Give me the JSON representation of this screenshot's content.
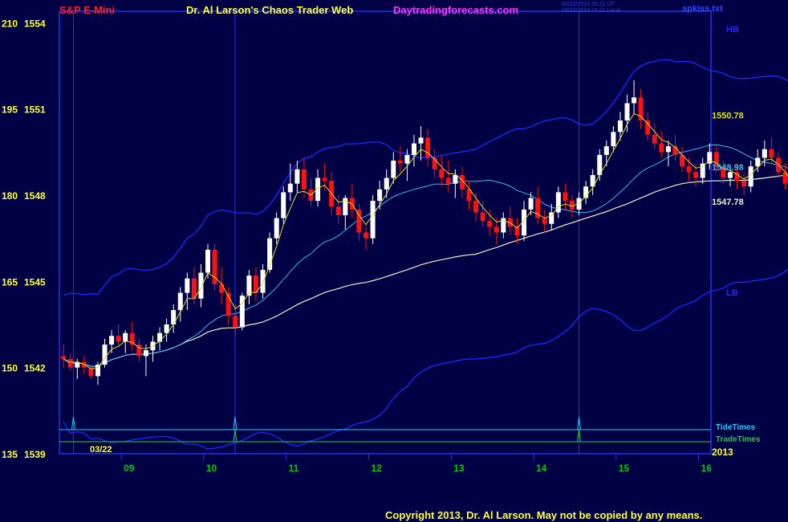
{
  "header": {
    "symbol": "S&P E-Mini",
    "site_title": "Dr. Al Larson's Chaos Trader Web",
    "site_url": "Daytradingforecasts.com",
    "timestamp_ut": "03/22/2013 20:21 UT",
    "timestamp_local": "03/22/2013 15:21 Local",
    "file": "spkiss.txt"
  },
  "footer": {
    "copyright": "Copyright 2013, Dr. Al Larson. May not be copied by any means."
  },
  "colors": {
    "background": "#000044",
    "frame": "#2233ee",
    "band": "#1a2bff",
    "cyan_ma": "#33bbee",
    "white_ma": "#eeeecc",
    "yellow_ma": "#dddd22",
    "up_candle": "#ffffff",
    "down_candle": "#ff1111",
    "tide_times": "#22ccff",
    "trade_times": "#22cc44",
    "date_label": "#00cc00",
    "y_label": "#ffff33"
  },
  "chart_data": {
    "type": "candlestick",
    "title": "S&P E-Mini",
    "y_axis": {
      "osc_ticks": [
        135,
        150,
        165,
        180,
        195,
        210
      ],
      "price_ticks": [
        1539,
        1542,
        1545,
        1548,
        1551,
        1554
      ],
      "range": [
        1539,
        1554.4
      ]
    },
    "x_axis": {
      "date_label": "03/22",
      "year_label": "2013",
      "hour_labels": [
        "09",
        "10",
        "11",
        "12",
        "13",
        "14",
        "15",
        "16"
      ],
      "range_hours": [
        8.25,
        16.15
      ]
    },
    "band_labels": {
      "upper": "HB",
      "lower": "LB"
    },
    "level_labels": [
      {
        "label": "1550.78",
        "price": 1550.78,
        "color": "yellow"
      },
      {
        "label": "1548.98",
        "price": 1548.98,
        "color": "cyan"
      },
      {
        "label": "1547.78",
        "price": 1547.78,
        "color": "white"
      }
    ],
    "vertical_markers_hours": [
      8.42,
      10.38,
      14.55
    ],
    "timing_lines": [
      {
        "name": "TideTimes",
        "spikes_hours": [
          8.42,
          10.38,
          14.55
        ]
      },
      {
        "name": "TradeTimes",
        "spikes_hours": [
          10.38,
          14.55
        ]
      }
    ],
    "candle_interval_min": 5,
    "candles_ohlc": [
      [
        1542.4,
        1542.8,
        1542.0,
        1542.3
      ],
      [
        1542.3,
        1542.5,
        1541.9,
        1542.0
      ],
      [
        1542.0,
        1542.3,
        1541.6,
        1542.2
      ],
      [
        1542.2,
        1542.4,
        1541.8,
        1542.0
      ],
      [
        1542.0,
        1542.1,
        1541.6,
        1541.7
      ],
      [
        1541.7,
        1542.2,
        1541.4,
        1542.1
      ],
      [
        1542.1,
        1543.0,
        1542.0,
        1542.8
      ],
      [
        1542.8,
        1543.3,
        1542.5,
        1543.1
      ],
      [
        1543.1,
        1543.5,
        1542.7,
        1542.9
      ],
      [
        1542.9,
        1543.3,
        1542.5,
        1543.2
      ],
      [
        1543.2,
        1543.6,
        1542.6,
        1542.8
      ],
      [
        1542.8,
        1543.0,
        1542.2,
        1542.4
      ],
      [
        1542.4,
        1542.8,
        1541.7,
        1542.6
      ],
      [
        1542.6,
        1543.1,
        1542.2,
        1542.9
      ],
      [
        1542.9,
        1543.4,
        1542.6,
        1543.2
      ],
      [
        1543.2,
        1543.7,
        1542.9,
        1543.5
      ],
      [
        1543.5,
        1544.2,
        1543.2,
        1544.0
      ],
      [
        1544.0,
        1544.8,
        1543.6,
        1544.6
      ],
      [
        1544.6,
        1545.3,
        1544.0,
        1545.1
      ],
      [
        1545.1,
        1545.5,
        1544.2,
        1544.4
      ],
      [
        1544.4,
        1545.6,
        1544.1,
        1545.3
      ],
      [
        1545.3,
        1546.3,
        1545.1,
        1546.1
      ],
      [
        1546.1,
        1546.3,
        1544.7,
        1544.9
      ],
      [
        1544.9,
        1545.5,
        1544.2,
        1544.6
      ],
      [
        1544.6,
        1544.8,
        1543.5,
        1543.8
      ],
      [
        1543.8,
        1544.2,
        1543.1,
        1543.4
      ],
      [
        1543.4,
        1544.6,
        1543.3,
        1544.5
      ],
      [
        1544.5,
        1545.4,
        1544.2,
        1545.2
      ],
      [
        1545.2,
        1545.5,
        1544.3,
        1544.6
      ],
      [
        1544.6,
        1545.6,
        1544.4,
        1545.4
      ],
      [
        1545.4,
        1546.7,
        1545.3,
        1546.5
      ],
      [
        1546.5,
        1547.4,
        1546.3,
        1547.2
      ],
      [
        1547.2,
        1548.3,
        1547.0,
        1548.1
      ],
      [
        1548.1,
        1549.1,
        1547.8,
        1548.4
      ],
      [
        1548.4,
        1549.2,
        1548.1,
        1548.9
      ],
      [
        1548.9,
        1549.3,
        1547.9,
        1548.2
      ],
      [
        1548.2,
        1548.6,
        1547.6,
        1547.8
      ],
      [
        1547.8,
        1548.9,
        1547.6,
        1548.6
      ],
      [
        1548.6,
        1549.1,
        1548.2,
        1548.5
      ],
      [
        1548.5,
        1548.8,
        1547.3,
        1547.6
      ],
      [
        1547.6,
        1548.0,
        1547.0,
        1547.3
      ],
      [
        1547.3,
        1548.0,
        1546.8,
        1547.9
      ],
      [
        1547.9,
        1548.4,
        1547.2,
        1547.5
      ],
      [
        1547.5,
        1547.7,
        1546.4,
        1546.7
      ],
      [
        1546.7,
        1547.0,
        1546.1,
        1546.5
      ],
      [
        1546.5,
        1548.0,
        1546.3,
        1547.8
      ],
      [
        1547.8,
        1548.5,
        1547.5,
        1548.2
      ],
      [
        1548.2,
        1548.9,
        1547.9,
        1548.6
      ],
      [
        1548.6,
        1549.5,
        1548.4,
        1549.2
      ],
      [
        1549.2,
        1549.7,
        1548.8,
        1549.1
      ],
      [
        1549.1,
        1549.6,
        1548.5,
        1549.4
      ],
      [
        1549.4,
        1550.1,
        1549.0,
        1549.8
      ],
      [
        1549.8,
        1550.4,
        1549.2,
        1550.0
      ],
      [
        1550.0,
        1550.3,
        1549.0,
        1549.3
      ],
      [
        1549.3,
        1549.6,
        1548.6,
        1548.9
      ],
      [
        1548.9,
        1549.4,
        1548.3,
        1548.6
      ],
      [
        1548.6,
        1549.2,
        1548.1,
        1548.4
      ],
      [
        1548.4,
        1548.9,
        1547.9,
        1548.7
      ],
      [
        1548.7,
        1549.0,
        1547.9,
        1548.2
      ],
      [
        1548.2,
        1548.5,
        1547.5,
        1547.8
      ],
      [
        1547.8,
        1548.1,
        1547.1,
        1547.4
      ],
      [
        1547.4,
        1547.8,
        1546.9,
        1547.1
      ],
      [
        1547.1,
        1547.5,
        1546.6,
        1546.9
      ],
      [
        1546.9,
        1547.2,
        1546.3,
        1546.7
      ],
      [
        1546.7,
        1547.4,
        1546.5,
        1547.2
      ],
      [
        1547.2,
        1547.6,
        1546.6,
        1546.9
      ],
      [
        1546.9,
        1547.2,
        1546.3,
        1546.6
      ],
      [
        1546.6,
        1547.8,
        1546.4,
        1547.5
      ],
      [
        1547.5,
        1548.1,
        1547.3,
        1547.9
      ],
      [
        1547.9,
        1548.3,
        1547.0,
        1547.2
      ],
      [
        1547.2,
        1547.5,
        1546.7,
        1547.0
      ],
      [
        1547.0,
        1547.7,
        1546.8,
        1547.4
      ],
      [
        1547.4,
        1548.3,
        1547.2,
        1548.1
      ],
      [
        1548.1,
        1548.4,
        1547.5,
        1547.8
      ],
      [
        1547.8,
        1548.0,
        1547.2,
        1547.5
      ],
      [
        1547.5,
        1548.1,
        1547.3,
        1547.9
      ],
      [
        1547.9,
        1548.5,
        1547.7,
        1548.3
      ],
      [
        1548.3,
        1548.9,
        1548.0,
        1548.7
      ],
      [
        1548.7,
        1549.6,
        1548.5,
        1549.4
      ],
      [
        1549.4,
        1549.9,
        1549.0,
        1549.7
      ],
      [
        1549.7,
        1550.4,
        1549.5,
        1550.2
      ],
      [
        1550.2,
        1550.9,
        1549.9,
        1550.6
      ],
      [
        1550.6,
        1551.5,
        1550.2,
        1551.2
      ],
      [
        1551.2,
        1552.0,
        1550.8,
        1551.4
      ],
      [
        1551.4,
        1551.7,
        1550.3,
        1550.6
      ],
      [
        1550.6,
        1550.9,
        1549.9,
        1550.1
      ],
      [
        1550.1,
        1550.5,
        1549.6,
        1549.8
      ],
      [
        1549.8,
        1550.2,
        1549.3,
        1549.5
      ],
      [
        1549.5,
        1549.9,
        1549.0,
        1549.7
      ],
      [
        1549.7,
        1550.1,
        1549.2,
        1549.4
      ],
      [
        1549.4,
        1549.7,
        1548.8,
        1549.0
      ],
      [
        1549.0,
        1549.3,
        1548.5,
        1548.8
      ],
      [
        1548.8,
        1549.1,
        1548.3,
        1548.6
      ],
      [
        1548.6,
        1549.3,
        1548.4,
        1549.1
      ],
      [
        1549.1,
        1549.8,
        1548.9,
        1549.5
      ],
      [
        1549.5,
        1549.7,
        1548.8,
        1549.0
      ],
      [
        1549.0,
        1549.2,
        1548.4,
        1548.6
      ],
      [
        1548.6,
        1549.0,
        1548.3,
        1548.8
      ],
      [
        1548.8,
        1549.1,
        1548.2,
        1548.5
      ],
      [
        1548.5,
        1548.8,
        1548.0,
        1548.3
      ],
      [
        1548.3,
        1549.2,
        1548.1,
        1549.0
      ],
      [
        1549.0,
        1549.6,
        1548.8,
        1549.3
      ],
      [
        1549.3,
        1549.9,
        1549.0,
        1549.6
      ],
      [
        1549.6,
        1550.0,
        1549.1,
        1549.3
      ],
      [
        1549.3,
        1549.5,
        1548.6,
        1548.8
      ],
      [
        1548.8,
        1549.1,
        1548.2,
        1548.4
      ],
      [
        1548.4,
        1548.6,
        1547.7,
        1547.9
      ],
      [
        1547.9,
        1548.2,
        1547.3,
        1547.5
      ],
      [
        1547.5,
        1547.8,
        1546.9,
        1547.1
      ],
      [
        1547.1,
        1547.3,
        1546.4,
        1546.6
      ],
      [
        1546.6,
        1546.9,
        1546.1,
        1546.4
      ],
      [
        1546.4,
        1547.1,
        1546.2,
        1546.9
      ],
      [
        1546.9,
        1547.5,
        1546.7,
        1547.2
      ],
      [
        1547.2,
        1548.0,
        1547.0,
        1547.8
      ],
      [
        1547.8,
        1548.3,
        1547.2,
        1547.5
      ],
      [
        1547.5,
        1547.9,
        1546.9,
        1547.2
      ],
      [
        1547.2,
        1548.1,
        1547.0,
        1547.8
      ],
      [
        1547.8,
        1548.0,
        1547.2,
        1547.4
      ],
      [
        1547.4,
        1547.6,
        1546.9,
        1547.1
      ],
      [
        1547.1,
        1547.3,
        1546.6,
        1546.9
      ],
      [
        1546.9,
        1551.3,
        1546.8,
        1551.0
      ],
      [
        1551.0,
        1552.1,
        1550.6,
        1551.8
      ],
      [
        1551.8,
        1552.6,
        1551.5,
        1552.3
      ],
      [
        1552.3,
        1553.1,
        1552.0,
        1552.6
      ]
    ]
  }
}
